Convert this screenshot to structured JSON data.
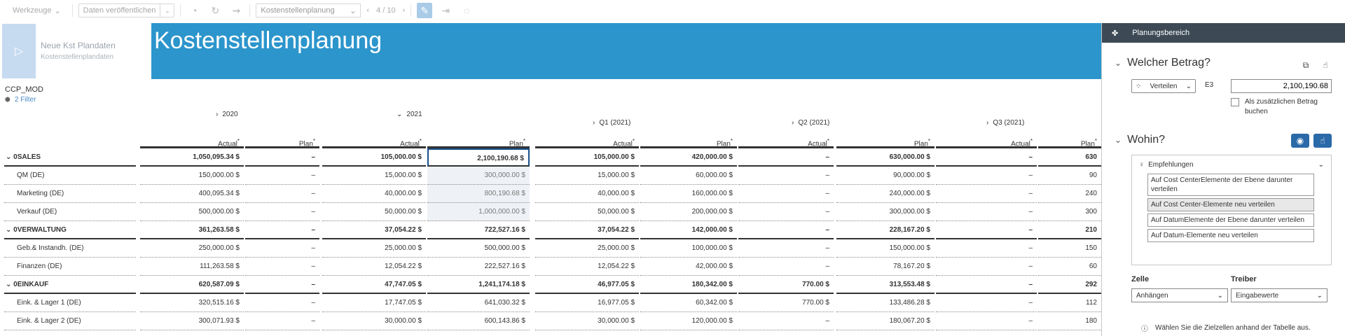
{
  "toolbar": {
    "tools_label": "Werkzeuge",
    "publish_label": "Daten veröffentlichen",
    "story_select": "Kostenstellenplanung",
    "pager": "4 / 10"
  },
  "tile": {
    "title": "Neue Kst Plandaten",
    "subtitle": "Kostenstellenplandaten"
  },
  "banner": {
    "title": "Kostenstellenplanung"
  },
  "model": {
    "name": "CCP_MOD",
    "filter": "2 Filter"
  },
  "table": {
    "years": [
      "2020",
      "2021"
    ],
    "quarters": [
      "Q1 (2021)",
      "Q2 (2021)",
      "Q3 (2021)"
    ],
    "columns": [
      "Actual",
      "Plan",
      "Actual",
      "Plan",
      "Actual",
      "Plan",
      "Actual",
      "Plan",
      "Actual",
      "Plan"
    ],
    "rows": [
      {
        "label": "0SALES",
        "bold": true,
        "values": [
          "1,050,095.34 $",
          "–",
          "105,000.00 $",
          "2,100,190.68 $",
          "105,000.00 $",
          "420,000.00 $",
          "–",
          "630,000.00 $",
          "–",
          "630"
        ]
      },
      {
        "label": "QM (DE)",
        "bold": false,
        "values": [
          "150,000.00 $",
          "–",
          "15,000.00 $",
          "300,000.00 $",
          "15,000.00 $",
          "60,000.00 $",
          "–",
          "90,000.00 $",
          "–",
          "90"
        ]
      },
      {
        "label": "Marketing (DE)",
        "bold": false,
        "values": [
          "400,095.34 $",
          "–",
          "40,000.00 $",
          "800,190.68 $",
          "40,000.00 $",
          "160,000.00 $",
          "–",
          "240,000.00 $",
          "–",
          "240"
        ]
      },
      {
        "label": "Verkauf (DE)",
        "bold": false,
        "values": [
          "500,000.00 $",
          "–",
          "50,000.00 $",
          "1,000,000.00 $",
          "50,000.00 $",
          "200,000.00 $",
          "–",
          "300,000.00 $",
          "–",
          "300"
        ]
      },
      {
        "label": "0VERWALTUNG",
        "bold": true,
        "values": [
          "361,263.58 $",
          "–",
          "37,054.22 $",
          "722,527.16 $",
          "37,054.22 $",
          "142,000.00 $",
          "–",
          "228,167.20 $",
          "–",
          "210"
        ]
      },
      {
        "label": "Geb.& Instandh. (DE)",
        "bold": false,
        "values": [
          "250,000.00 $",
          "–",
          "25,000.00 $",
          "500,000.00 $",
          "25,000.00 $",
          "100,000.00 $",
          "–",
          "150,000.00 $",
          "–",
          "150"
        ]
      },
      {
        "label": "Finanzen (DE)",
        "bold": false,
        "values": [
          "111,263.58 $",
          "–",
          "12,054.22 $",
          "222,527.16 $",
          "12,054.22 $",
          "42,000.00 $",
          "–",
          "78,167.20 $",
          "–",
          "60"
        ]
      },
      {
        "label": "0EINKAUF",
        "bold": true,
        "values": [
          "620,587.09 $",
          "–",
          "47,747.05 $",
          "1,241,174.18 $",
          "46,977.05 $",
          "180,342.00 $",
          "770.00 $",
          "313,553.48 $",
          "–",
          "292"
        ]
      },
      {
        "label": "Eink. & Lager 1 (DE)",
        "bold": false,
        "values": [
          "320,515.16 $",
          "–",
          "17,747.05 $",
          "641,030.32 $",
          "16,977.05 $",
          "60,342.00 $",
          "770.00 $",
          "133,486.28 $",
          "–",
          "112"
        ]
      },
      {
        "label": "Eink. & Lager 2 (DE)",
        "bold": false,
        "values": [
          "300,071.93 $",
          "–",
          "30,000.00 $",
          "600,143.86 $",
          "30,000.00 $",
          "120,000.00 $",
          "–",
          "180,067.20 $",
          "–",
          "180"
        ]
      }
    ]
  },
  "panel": {
    "header": "Planungsbereich",
    "amount_title": "Welcher Betrag?",
    "distribute_label": "Verteilen",
    "cell_ref": "E3",
    "amount_value": "2,100,190.68",
    "additional_label": "Als zusätzlichen Betrag buchen",
    "where_title": "Wohin?",
    "reco_header": "Empfehlungen",
    "recommendations": [
      "Auf Cost CenterElemente der Ebene darunter verteilen",
      "Auf Cost Center-Elemente neu verteilen",
      "Auf DatumElemente der Ebene darunter verteilen",
      "Auf Datum-Elemente neu verteilen"
    ],
    "cell_label": "Zelle",
    "cell_value": "Anhängen",
    "driver_label": "Treiber",
    "driver_value": "Eingabewerte",
    "info_text": "Wählen Sie die Zielzellen anhand der Tabelle aus."
  }
}
